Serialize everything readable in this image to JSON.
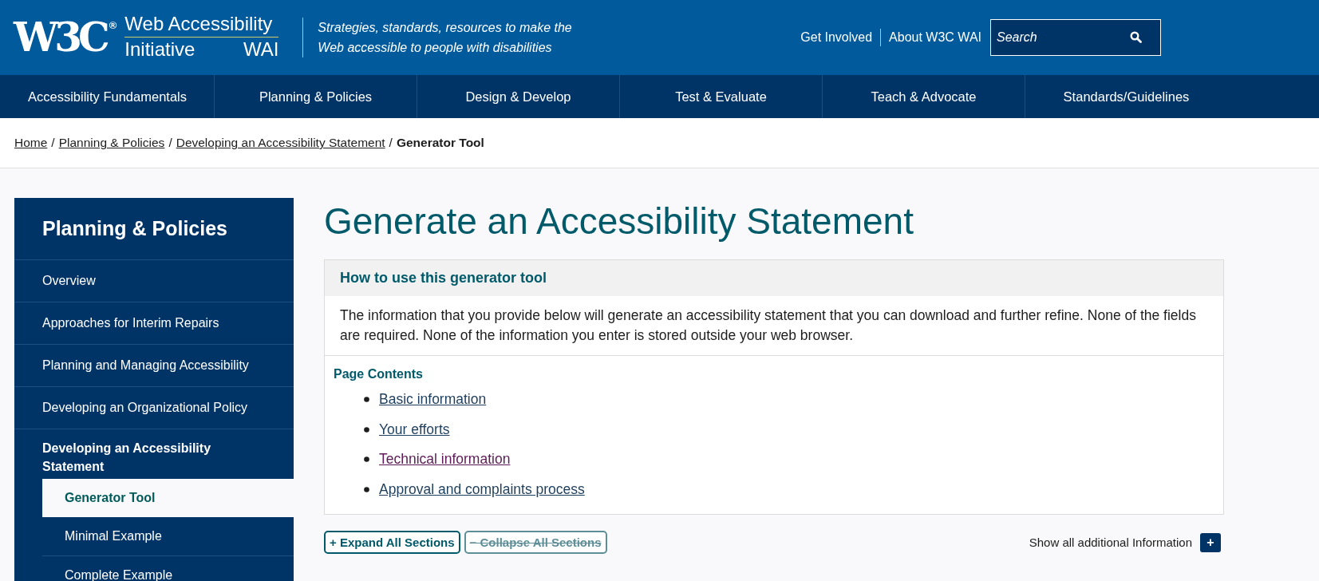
{
  "header": {
    "logo": "W3C",
    "logo_mark": "®",
    "site_name_line1": "Web Accessibility",
    "site_name_line2": "Initiative",
    "site_abbr": "WAI",
    "tagline": "Strategies, standards, resources to make the Web accessible to people with disabilities",
    "links": [
      "Get Involved",
      "About W3C WAI"
    ],
    "search": {
      "placeholder": "Search"
    }
  },
  "nav": [
    {
      "label": "Accessibility Fundamentals",
      "selected": false
    },
    {
      "label": "Planning & Policies",
      "selected": false
    },
    {
      "label": "Design & Develop",
      "selected": false
    },
    {
      "label": "Test & Evaluate",
      "selected": false
    },
    {
      "label": "Teach & Advocate",
      "selected": false
    },
    {
      "label": "Standards/Guidelines",
      "selected": false
    }
  ],
  "breadcrumb": {
    "links": [
      "Home",
      "Planning & Policies",
      "Developing an Accessibility Statement"
    ],
    "separator": "/",
    "current": "Generator Tool"
  },
  "sidebar": {
    "title": "Planning & Policies",
    "items": [
      {
        "label": "Overview",
        "selected": false
      },
      {
        "label": "Approaches for Interim Repairs",
        "selected": false
      },
      {
        "label": "Planning and Managing Accessibility",
        "selected": false
      },
      {
        "label": "Developing an Organizational Policy",
        "selected": false
      },
      {
        "label": "Developing an Accessibility Statement",
        "selected": false,
        "expanded": true,
        "children": [
          {
            "label": "Generator Tool",
            "selected": true
          },
          {
            "label": "Minimal Example",
            "selected": false
          },
          {
            "label": "Complete Example",
            "selected": false
          }
        ]
      }
    ]
  },
  "main": {
    "title": "Generate an Accessibility Statement",
    "info_box": {
      "title": "How to use this generator tool",
      "text": "The information that you provide below will generate an accessibility statement that you can download and further refine. None of the fields are required. None of the information you enter is stored outside your web browser."
    },
    "page_contents": {
      "title": "Page Contents",
      "links": [
        {
          "label": "Basic information",
          "visited": false
        },
        {
          "label": "Your efforts",
          "visited": false
        },
        {
          "label": "Technical information",
          "visited": true
        },
        {
          "label": "Approval and complaints process",
          "visited": false
        }
      ]
    },
    "buttons": [
      {
        "label": "+ Expand All Sections",
        "disabled": false
      },
      {
        "label": "− Collapse All Sections",
        "disabled": true
      }
    ],
    "additional": {
      "label": "Show all additional Information",
      "button": "+"
    }
  }
}
